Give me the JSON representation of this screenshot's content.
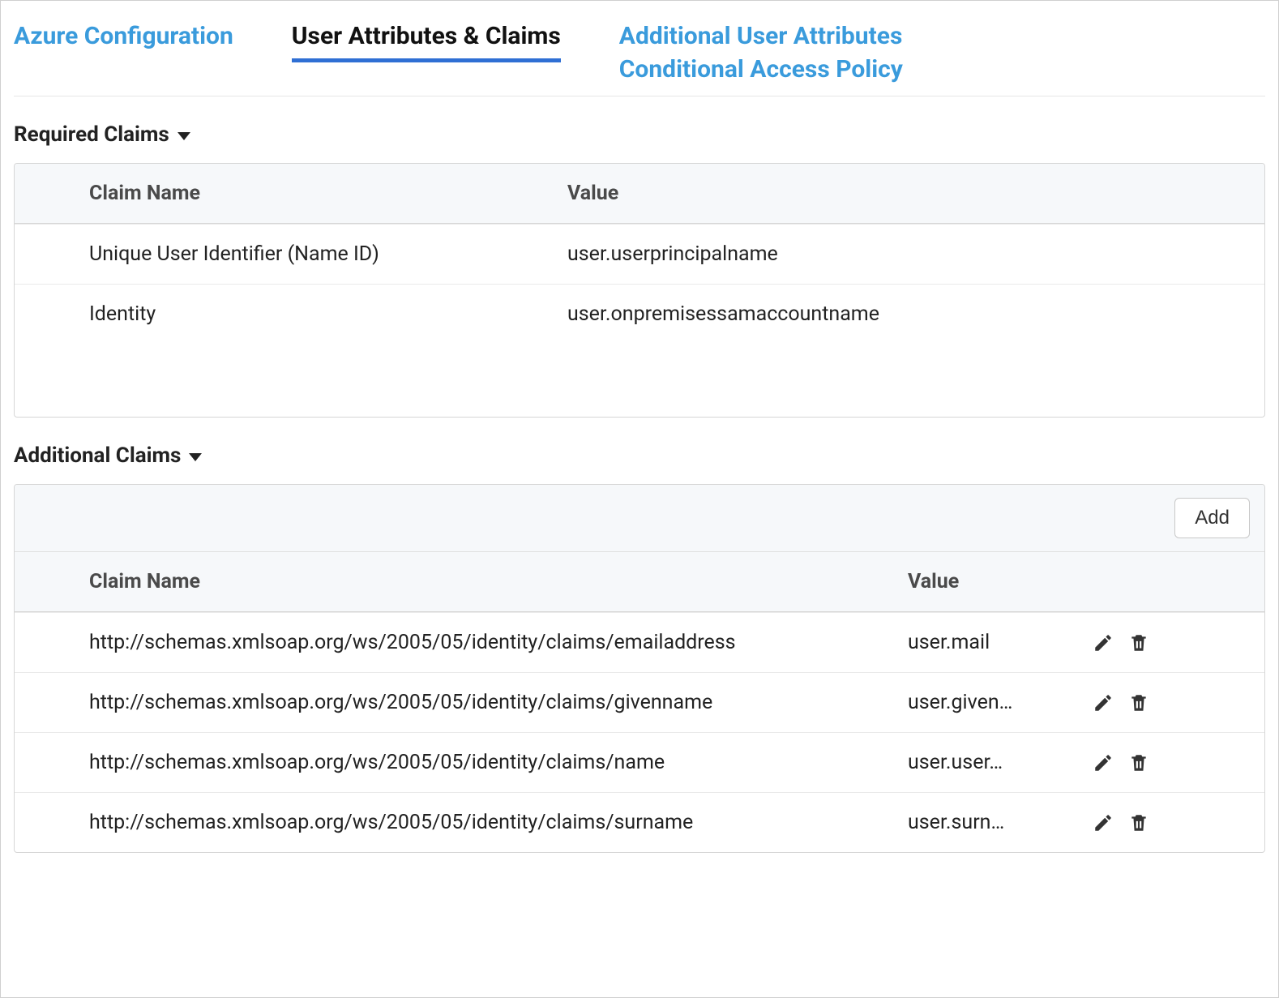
{
  "tabs": {
    "azure_config": "Azure Configuration",
    "user_attrs": "User Attributes & Claims",
    "additional_attrs": "Additional User Attributes",
    "conditional_access": "Conditional Access Policy"
  },
  "required": {
    "title": "Required Claims",
    "col_name": "Claim Name",
    "col_value": "Value",
    "rows": [
      {
        "name": "Unique User Identifier (Name ID)",
        "value": "user.userprincipalname"
      },
      {
        "name": "Identity",
        "value": "user.onpremisessamaccountname"
      }
    ]
  },
  "additional": {
    "title": "Additional Claims",
    "add_label": "Add",
    "col_name": "Claim Name",
    "col_value": "Value",
    "rows": [
      {
        "name": "http://schemas.xmlsoap.org/ws/2005/05/identity/claims/emailaddress",
        "value": "user.mail"
      },
      {
        "name": "http://schemas.xmlsoap.org/ws/2005/05/identity/claims/givenname",
        "value": "user.given…"
      },
      {
        "name": "http://schemas.xmlsoap.org/ws/2005/05/identity/claims/name",
        "value": "user.user…"
      },
      {
        "name": "http://schemas.xmlsoap.org/ws/2005/05/identity/claims/surname",
        "value": "user.surn…"
      }
    ]
  }
}
